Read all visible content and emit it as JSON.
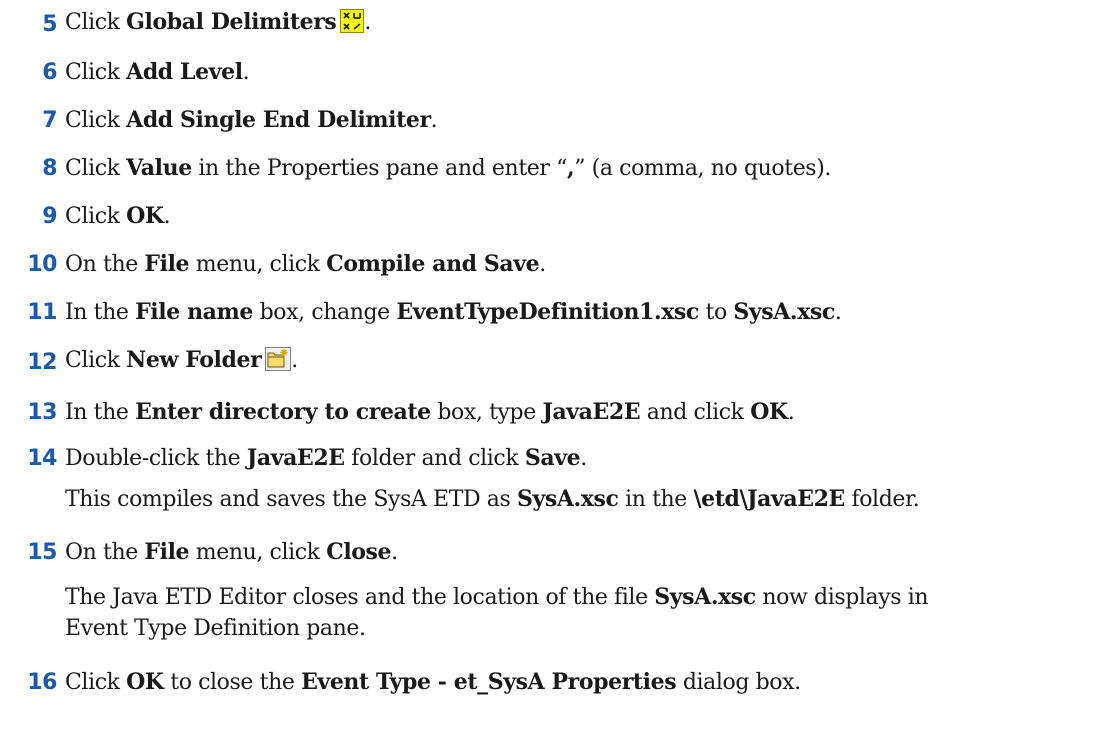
{
  "steps": [
    {
      "number": "5",
      "parts": [
        {
          "t": "Click "
        },
        {
          "t": "Global Delimiters",
          "b": true
        },
        {
          "icon": "global-delimiters-icon"
        },
        {
          "t": "."
        }
      ]
    },
    {
      "number": "6",
      "parts": [
        {
          "t": "Click "
        },
        {
          "t": "Add Level",
          "b": true
        },
        {
          "t": "."
        }
      ]
    },
    {
      "number": "7",
      "parts": [
        {
          "t": "Click "
        },
        {
          "t": "Add Single End Delimiter",
          "b": true
        },
        {
          "t": "."
        }
      ]
    },
    {
      "number": "8",
      "parts": [
        {
          "t": "Click "
        },
        {
          "t": "Value",
          "b": true
        },
        {
          "t": " in the Properties pane and enter “"
        },
        {
          "t": ",",
          "b": true
        },
        {
          "t": "” (a comma, no quotes)."
        }
      ]
    },
    {
      "number": "9",
      "parts": [
        {
          "t": "Click "
        },
        {
          "t": "OK",
          "b": true
        },
        {
          "t": "."
        }
      ]
    },
    {
      "number": "10",
      "parts": [
        {
          "t": "On the "
        },
        {
          "t": "File",
          "b": true
        },
        {
          "t": " menu, click "
        },
        {
          "t": "Compile and Save",
          "b": true
        },
        {
          "t": "."
        }
      ]
    },
    {
      "number": "11",
      "parts": [
        {
          "t": "In the "
        },
        {
          "t": "File name",
          "b": true
        },
        {
          "t": " box, change "
        },
        {
          "t": "EventTypeDefinition1.xsc",
          "b": true
        },
        {
          "t": " to "
        },
        {
          "t": "SysA.xsc",
          "b": true
        },
        {
          "t": "."
        }
      ]
    },
    {
      "number": "12",
      "parts": [
        {
          "t": "Click "
        },
        {
          "t": "New Folder",
          "b": true
        },
        {
          "icon": "new-folder-icon"
        },
        {
          "t": "."
        }
      ]
    },
    {
      "number": "13",
      "parts": [
        {
          "t": "In the "
        },
        {
          "t": "Enter directory to create",
          "b": true
        },
        {
          "t": " box, type "
        },
        {
          "t": "JavaE2E",
          "b": true
        },
        {
          "t": " and click "
        },
        {
          "t": "OK",
          "b": true
        },
        {
          "t": "."
        }
      ]
    },
    {
      "number": "14",
      "parts": [
        {
          "t": "Double-click the "
        },
        {
          "t": "JavaE2E",
          "b": true
        },
        {
          "t": " folder and click "
        },
        {
          "t": "Save",
          "b": true
        },
        {
          "t": "."
        }
      ]
    },
    {
      "number": "15",
      "parts": [
        {
          "t": "On the "
        },
        {
          "t": "File",
          "b": true
        },
        {
          "t": " menu, click "
        },
        {
          "t": "Close",
          "b": true
        },
        {
          "t": "."
        }
      ]
    },
    {
      "number": "16",
      "parts": [
        {
          "t": "Click "
        },
        {
          "t": "OK",
          "b": true
        },
        {
          "t": " to close the "
        },
        {
          "t": "Event Type - et_SysA Properties",
          "b": true
        },
        {
          "t": " dialog box."
        }
      ]
    }
  ],
  "notes": [
    {
      "lines": [
        [
          {
            "t": "This compiles and saves the SysA ETD as "
          },
          {
            "t": "SysA.xsc",
            "b": true
          },
          {
            "t": " in the "
          },
          {
            "t": "\\etd\\JavaE2E",
            "b": true
          },
          {
            "t": " folder."
          }
        ]
      ]
    },
    {
      "lines": [
        [
          {
            "t": "The Java ETD Editor closes and the location of the file "
          },
          {
            "t": "SysA.xsc",
            "b": true
          },
          {
            "t": " now displays in"
          }
        ],
        [
          {
            "t": "Event Type Definition pane."
          }
        ]
      ]
    }
  ]
}
